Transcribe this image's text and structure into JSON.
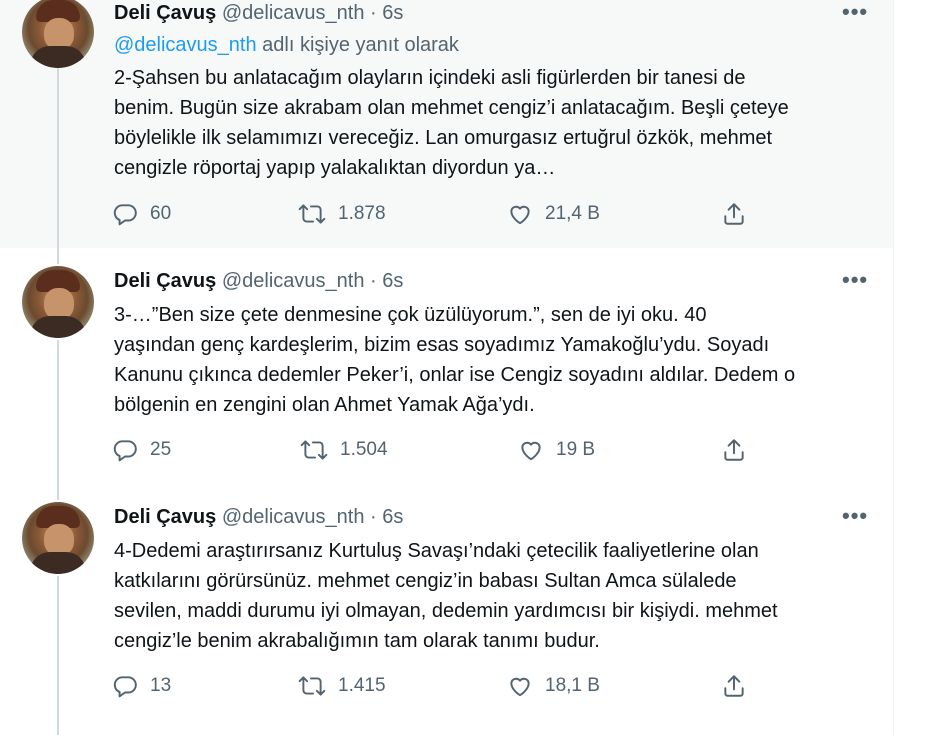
{
  "tweets": [
    {
      "name": "Deli Çavuş",
      "handle": "@delicavus_nth",
      "separator": "·",
      "time": "6s",
      "reply_prefix_handle": "@delicavus_nth",
      "reply_suffix": "adlı kişiye yanıt olarak",
      "text": "2-Şahsen bu anlatacağım olayların içindeki asli figürlerden bir tanesi de\nbenim. Bugün size akrabam olan mehmet cengiz’i anlatacağım. Beşli çeteye\nböylelikle ilk selamımızı vereceğiz. Lan omurgasız ertuğrul özkök, mehmet\ncengizle röportaj yapıp yalakalıktan diyordun ya…",
      "replies": "60",
      "retweets": "1.878",
      "likes": "21,4 B"
    },
    {
      "name": "Deli Çavuş",
      "handle": "@delicavus_nth",
      "separator": "·",
      "time": "6s",
      "text": "3-…”Ben size çete denmesine çok üzülüyorum.”, sen de iyi oku. 40\nyaşından genç kardeşlerim, bizim esas soyadımız Yamakoğlu’ydu. Soyadı\nKanunu çıkınca dedemler Peker’i, onlar ise Cengiz soyadını aldılar. Dedem o\nbölgenin en zengini olan Ahmet Yamak Ağa’ydı.",
      "replies": "25",
      "retweets": "1.504",
      "likes": "19 B"
    },
    {
      "name": "Deli Çavuş",
      "handle": "@delicavus_nth",
      "separator": "·",
      "time": "6s",
      "text": "4-Dedemi araştırırsanız Kurtuluş Savaşı’ndaki çetecilik faaliyetlerine olan\nkatkılarını görürsünüz. mehmet cengiz’in babası Sultan Amca sülalede\nsevilen, maddi durumu iyi olmayan, dedemin yardımcısı bir kişiydi. mehmet\ncengiz’le benim akrabalığımın tam olarak tanımı budur.",
      "replies": "13",
      "retweets": "1.415",
      "likes": "18,1 B"
    }
  ],
  "icons": {
    "more": "more-icon",
    "reply": "reply-icon",
    "retweet": "retweet-icon",
    "like": "like-icon",
    "share": "share-icon"
  },
  "colors": {
    "link": "#1d9bf0",
    "secondary_text": "#536471",
    "highlight_bg": "#f7f9f9"
  },
  "more_glyph": "•••"
}
